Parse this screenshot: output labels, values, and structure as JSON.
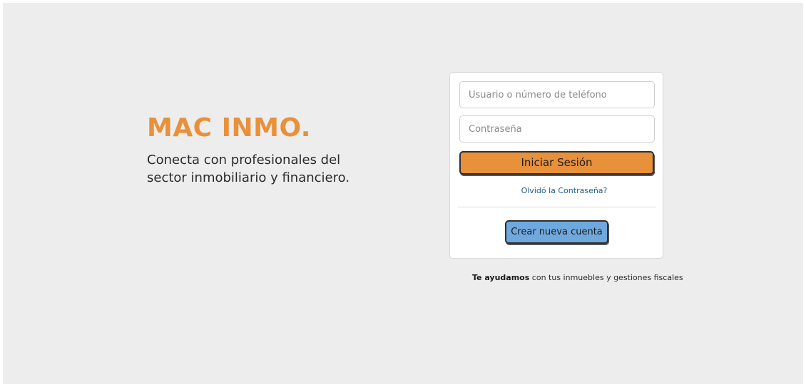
{
  "brand": {
    "name": "MAC INMO.",
    "tagline": "Conecta con profesionales del sector inmobiliario y financiero.",
    "accent_color": "#e8903a"
  },
  "login": {
    "username_placeholder": "Usuario o número de teléfono",
    "username_value": "",
    "password_placeholder": "Contraseña",
    "password_value": "",
    "submit_label": "Iniciar Sesión",
    "forgot_link": "Olvidó la Contraseña?",
    "create_account_label": "Crear nueva cuenta",
    "submit_color": "#e8903a",
    "create_color": "#6fa8dc"
  },
  "footer": {
    "emphasis": "Te ayudamos",
    "rest": " con tus inmuebles y gestiones fiscales"
  }
}
